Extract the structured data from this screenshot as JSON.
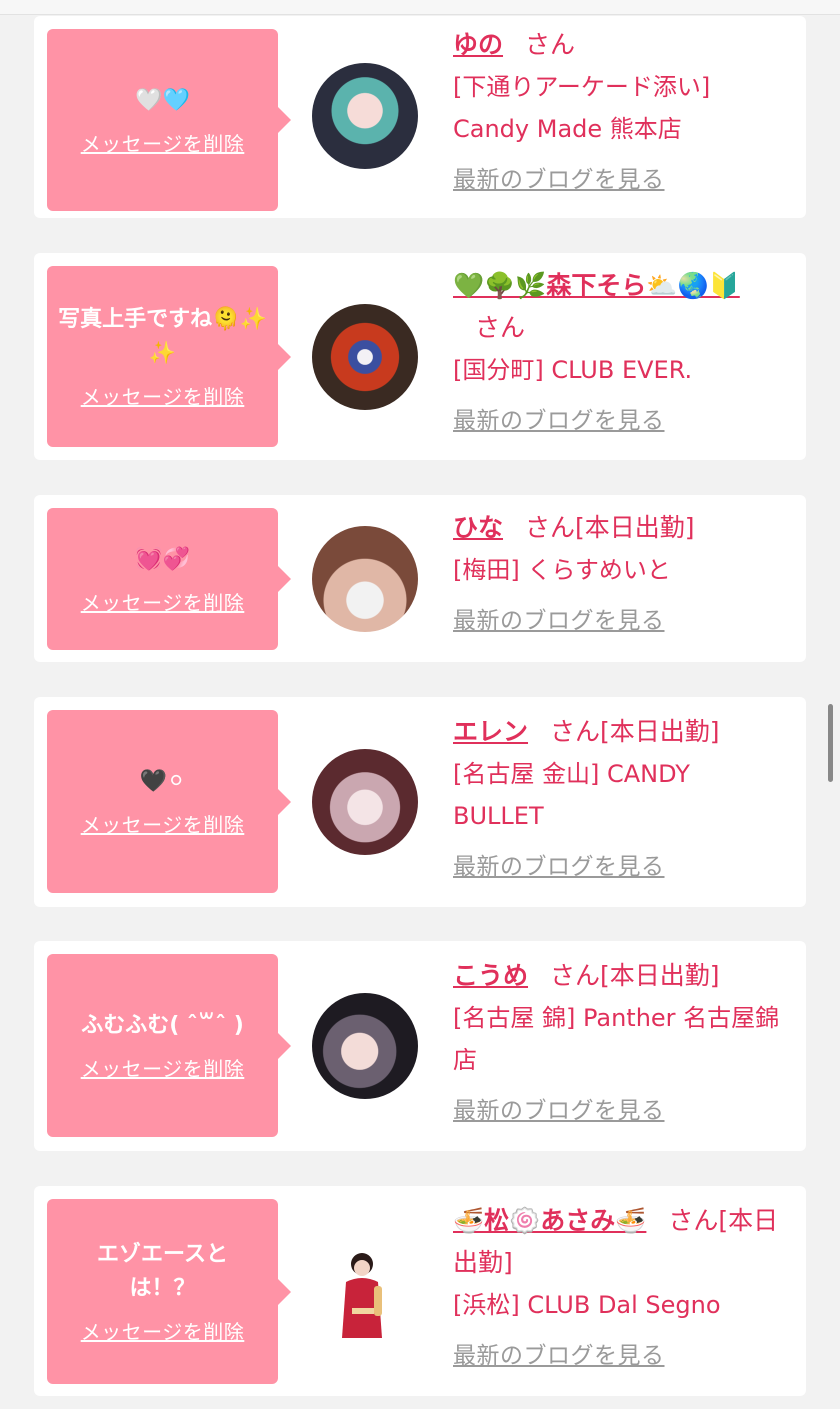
{
  "delete_label": "メッセージを削除",
  "blog_label": "最新のブログを見る",
  "honorific": "さん",
  "today_badge": "[本日出勤]",
  "cards": [
    {
      "message": "🤍🩵",
      "name": "ゆの",
      "shop": "[下通りアーケード添い] Candy Made 熊本店"
    },
    {
      "message": "写真上手ですね🫠✨✨",
      "name": "💚🌳🌿森下そら⛅🌏🔰",
      "shop": "[国分町] CLUB EVER."
    },
    {
      "message": "💓💞",
      "name": "ひな",
      "shop": "[梅田] くらすめいと"
    },
    {
      "message": "🖤⚪",
      "name": "エレン",
      "shop": "[名古屋 金山] CANDY BULLET"
    },
    {
      "message": "ふむふむ( ˆ꒳ˆ )",
      "name": "こうめ",
      "shop": "[名古屋 錦] Panther 名古屋錦店"
    },
    {
      "message": "エゾエースとは！？",
      "name": "🍜松🍥あさみ🍜",
      "shop": "[浜松] CLUB Dal Segno"
    }
  ]
}
